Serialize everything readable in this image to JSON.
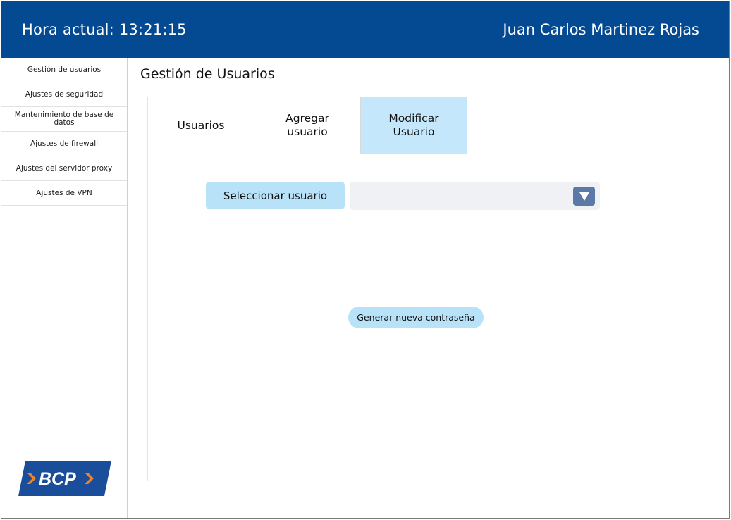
{
  "header": {
    "clock": "Hora actual: 13:21:15",
    "user_name": "Juan Carlos Martinez Rojas"
  },
  "sidebar": {
    "items": [
      {
        "label": "Gestión de usuarios"
      },
      {
        "label": "Ajustes de seguridad"
      },
      {
        "label": "Mantenimiento de base de datos"
      },
      {
        "label": "Ajustes de firewall"
      },
      {
        "label": "Ajustes del servidor proxy"
      },
      {
        "label": "Ajustes de VPN"
      }
    ],
    "logo_text": "BCP"
  },
  "main": {
    "title": "Gestión de Usuarios",
    "tabs": [
      {
        "label": "Usuarios"
      },
      {
        "label": "Agregar usuario"
      },
      {
        "label": "Modificar Usuario",
        "active": true
      }
    ],
    "select_label": "Seleccionar usuario",
    "select_value": "",
    "generate_button": "Generar nueva contraseña"
  },
  "colors": {
    "header_bg": "#034a93",
    "active_tab": "#c4e7fb",
    "button_bg": "#b7e2f7",
    "dropdown_arrow": "#5b78a6",
    "logo_bg": "#1a4e9b",
    "logo_accent": "#f5821f"
  },
  "icons": {
    "dropdown": "triangle-down-icon"
  }
}
